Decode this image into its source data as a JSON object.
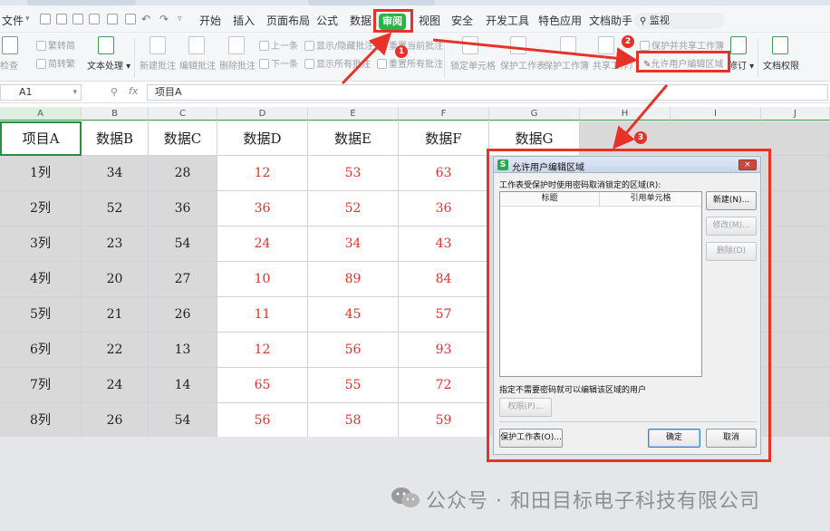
{
  "menubar": {
    "file": "文件",
    "tabs": [
      "开始",
      "插入",
      "页面布局",
      "公式",
      "数据",
      "审阅",
      "视图",
      "安全",
      "开发工具",
      "特色应用",
      "文档助手"
    ],
    "active_tab": "审阅",
    "search": "监视"
  },
  "ribbon": {
    "check": "检查",
    "trad_to_simp": "繁转简",
    "simp_to_trad": "简转繁",
    "text_processing": "文本处理",
    "new_comment": "新建批注",
    "edit_comment": "编辑批注",
    "delete_comment": "删除批注",
    "prev": "上一条",
    "next": "下一条",
    "show_hide_comment": "显示/隐藏批注",
    "show_all_comments": "显示所有批注",
    "reset_current_comment": "重置当前批注",
    "reset_all_comments": "重置所有批注",
    "lock_cell": "锁定单元格",
    "protect_sheet": "保护工作表",
    "protect_workbook": "保护工作簿",
    "share_workbook": "共享工作簿",
    "protect_and_share": "保护并共享工作簿",
    "allow_edit_ranges": "允许用户编辑区域",
    "track_changes": "修订",
    "doc_permission": "文档权限"
  },
  "formula": {
    "cell_ref": "A1",
    "fx": "fx",
    "content": "项目A"
  },
  "sheet": {
    "columns": [
      "A",
      "B",
      "C",
      "D",
      "E",
      "F",
      "G",
      "H",
      "I",
      "J"
    ],
    "header_row": [
      "项目A",
      "数据B",
      "数据C",
      "数据D",
      "数据E",
      "数据F",
      "数据G"
    ],
    "rows": [
      [
        "1列",
        "34",
        "28",
        "12",
        "53",
        "63"
      ],
      [
        "2列",
        "52",
        "36",
        "36",
        "52",
        "36"
      ],
      [
        "3列",
        "23",
        "54",
        "24",
        "34",
        "43"
      ],
      [
        "4列",
        "20",
        "27",
        "10",
        "89",
        "84"
      ],
      [
        "5列",
        "21",
        "26",
        "11",
        "45",
        "57"
      ],
      [
        "6列",
        "22",
        "13",
        "12",
        "56",
        "93"
      ],
      [
        "7列",
        "24",
        "14",
        "65",
        "55",
        "72"
      ],
      [
        "8列",
        "26",
        "54",
        "56",
        "58",
        "59"
      ]
    ]
  },
  "annotations": {
    "step1": "1",
    "step2": "2",
    "step3": "3"
  },
  "dialog": {
    "title": "允许用户编辑区域",
    "close": "×",
    "prompt": "工作表受保护时使用密码取消锁定的区域(R):",
    "col_title": "标题",
    "col_ref": "引用单元格",
    "new_btn": "新建(N)...",
    "modify_btn": "修改(M)...",
    "delete_btn": "删除(D)",
    "users_prompt": "指定不需要密码就可以编辑该区域的用户",
    "perm_btn": "权限(P)...",
    "protect_btn": "保护工作表(O)...",
    "ok_btn": "确定",
    "cancel_btn": "取消"
  },
  "watermark": {
    "text": "公众号 · 和田目标电子科技有限公司"
  },
  "colors": {
    "accent_green": "#2bb34a",
    "annotation_red": "#e63229",
    "data_red": "#e0322b"
  }
}
